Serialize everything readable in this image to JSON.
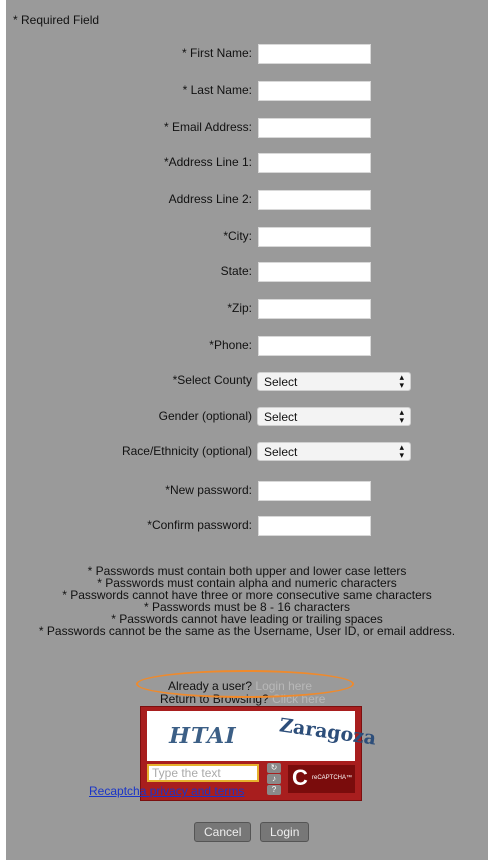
{
  "required_note": "* Required Field",
  "fields": [
    {
      "label": "* First Name:"
    },
    {
      "label": "* Last Name:"
    },
    {
      "label": "* Email Address:"
    },
    {
      "label": "*Address Line 1:"
    },
    {
      "label": "Address Line 2:"
    },
    {
      "label": "*City:"
    },
    {
      "label": "State:"
    },
    {
      "label": "*Zip:"
    },
    {
      "label": "*Phone:"
    }
  ],
  "selects": [
    {
      "label": "*Select County",
      "value": "Select"
    },
    {
      "label": "Gender (optional)",
      "value": "Select"
    },
    {
      "label": "Race/Ethnicity (optional)",
      "value": "Select"
    }
  ],
  "passwords": [
    {
      "label": "*New password:"
    },
    {
      "label": "*Confirm password:"
    }
  ],
  "rules": [
    "* Passwords must contain both upper and lower case letters",
    "* Passwords must contain alpha and numeric characters",
    "* Passwords cannot have three or more consecutive same characters",
    "* Passwords must be 8 - 16 characters",
    "* Passwords cannot have leading or trailing spaces",
    "* Passwords cannot be the same as the Username, User ID, or email address."
  ],
  "already_user": {
    "text": "Already a user?",
    "link": "Login here"
  },
  "return_browsing": {
    "text": "Return to Browsing?",
    "link": "Click here"
  },
  "captcha": {
    "word1": "HTAI",
    "word2": "Zaragoza",
    "placeholder": "Type the text",
    "logo_text": "reCAPTCHA™",
    "privacy": "Recaptcha privacy and terms"
  },
  "buttons": {
    "cancel": "Cancel",
    "login": "Login"
  },
  "colors": {
    "panel": "#9a9a9a",
    "captcha": "#a81e1e",
    "highlight_oval": "#ef8a2c",
    "link": "#1a35c7"
  }
}
